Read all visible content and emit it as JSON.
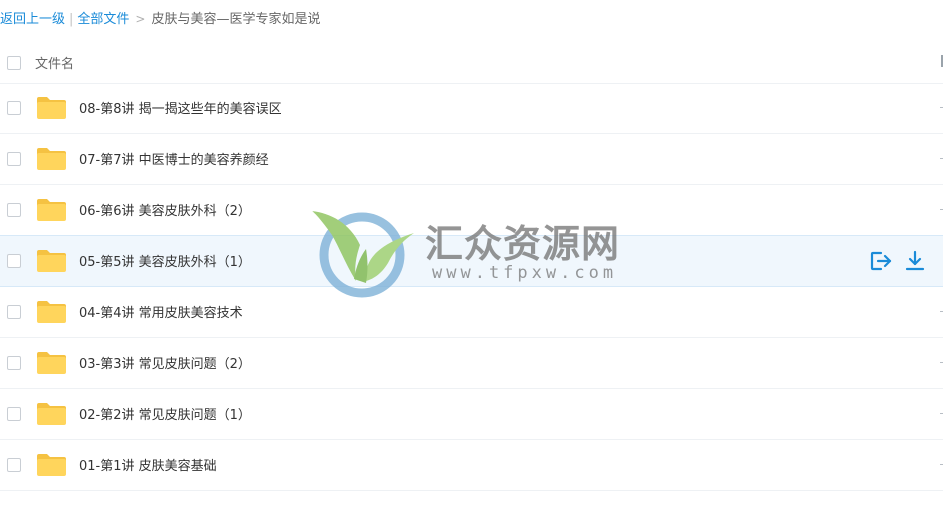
{
  "breadcrumb": {
    "back_label": "返回上一级",
    "separator": "|",
    "all_files_label": "全部文件",
    "arrow": ">",
    "current": "皮肤与美容—医学专家如是说"
  },
  "list": {
    "column_name": "文件名",
    "rows": [
      {
        "name": "08-第8讲 揭一揭这些年的美容误区",
        "type": "folder"
      },
      {
        "name": "07-第7讲 中医博士的美容养颜经",
        "type": "folder"
      },
      {
        "name": "06-第6讲 美容皮肤外科（2）",
        "type": "folder"
      },
      {
        "name": "05-第5讲 美容皮肤外科（1）",
        "type": "folder",
        "hovered": true
      },
      {
        "name": "04-第4讲 常用皮肤美容技术",
        "type": "folder"
      },
      {
        "name": "03-第3讲 常见皮肤问题（2）",
        "type": "folder"
      },
      {
        "name": "02-第2讲 常见皮肤问题（1）",
        "type": "folder"
      },
      {
        "name": "01-第1讲 皮肤美容基础",
        "type": "folder"
      }
    ]
  },
  "row_actions": {
    "icons": [
      "share-out-icon",
      "download-icon"
    ]
  },
  "watermark": {
    "title": "汇众资源网",
    "url": "www.tfpxw.com"
  },
  "colors": {
    "link": "#1a8bd8",
    "folder": "#ffd55c",
    "folder_tab": "#f5c242",
    "hover_row": "#f0f7fd",
    "action_icon": "#1a8bd8"
  }
}
